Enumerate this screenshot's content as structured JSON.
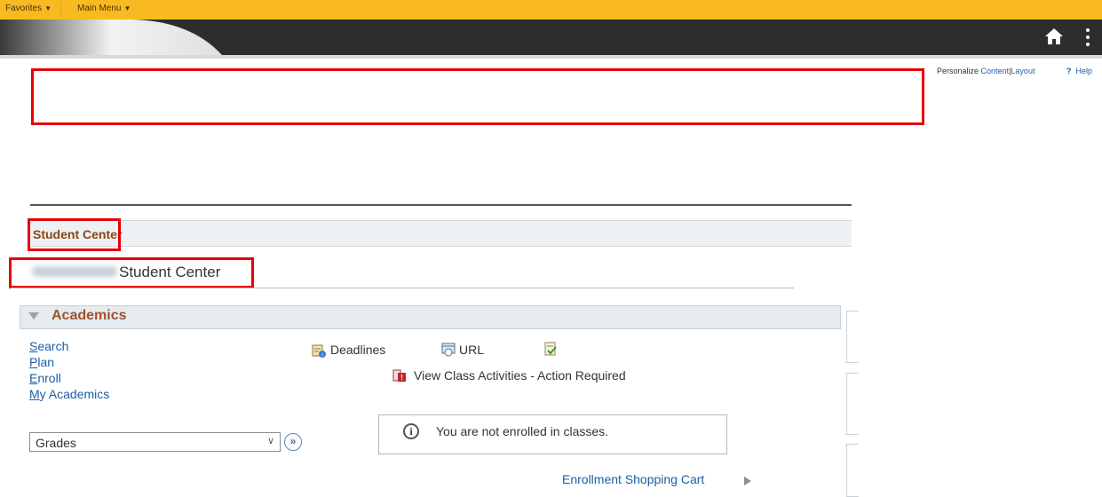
{
  "top_menu": {
    "favorites": "Favorites",
    "main_menu": "Main Menu"
  },
  "header_icons": {
    "home": "home-icon",
    "more": "kebab-icon"
  },
  "personalize": {
    "prefix": "Personalize",
    "content": "Content",
    "separator": "|",
    "layout": "Layout",
    "help": "Help",
    "help_icon": "?"
  },
  "banner": {
    "title": "Student Center",
    "subtitle": "Student Center"
  },
  "academics": {
    "title": "Academics",
    "links": [
      {
        "first": "S",
        "rest": "earch"
      },
      {
        "first": "P",
        "rest": "lan"
      },
      {
        "first": "E",
        "rest": "nroll"
      },
      {
        "first": "M",
        "rest": "y Academics"
      }
    ],
    "actions": {
      "deadlines": "Deadlines",
      "url": "URL",
      "class_activities": "View Class Activities - Action Required"
    },
    "select": {
      "value": "Grades"
    },
    "info_message": "You are not enrolled in classes.",
    "cart_link": "Enrollment Shopping Cart"
  },
  "colors": {
    "menu_bar": "#f9b921",
    "header": "#2d2d2d",
    "link": "#1a5fa8",
    "section_title": "#a0522d",
    "annotation": "#e60000"
  }
}
